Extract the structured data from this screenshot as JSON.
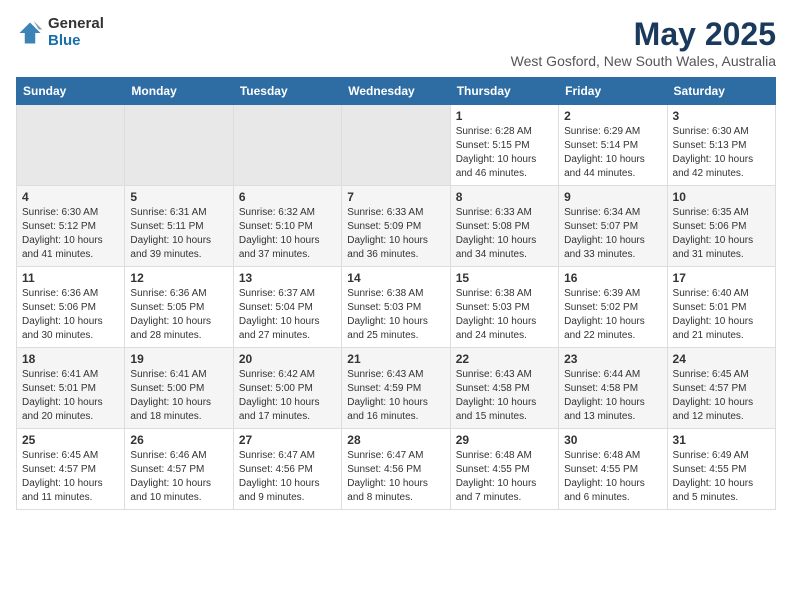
{
  "header": {
    "logo_general": "General",
    "logo_blue": "Blue",
    "title": "May 2025",
    "subtitle": "West Gosford, New South Wales, Australia"
  },
  "calendar": {
    "weekdays": [
      "Sunday",
      "Monday",
      "Tuesday",
      "Wednesday",
      "Thursday",
      "Friday",
      "Saturday"
    ],
    "weeks": [
      [
        {
          "day": "",
          "info": ""
        },
        {
          "day": "",
          "info": ""
        },
        {
          "day": "",
          "info": ""
        },
        {
          "day": "",
          "info": ""
        },
        {
          "day": "1",
          "info": "Sunrise: 6:28 AM\nSunset: 5:15 PM\nDaylight: 10 hours\nand 46 minutes."
        },
        {
          "day": "2",
          "info": "Sunrise: 6:29 AM\nSunset: 5:14 PM\nDaylight: 10 hours\nand 44 minutes."
        },
        {
          "day": "3",
          "info": "Sunrise: 6:30 AM\nSunset: 5:13 PM\nDaylight: 10 hours\nand 42 minutes."
        }
      ],
      [
        {
          "day": "4",
          "info": "Sunrise: 6:30 AM\nSunset: 5:12 PM\nDaylight: 10 hours\nand 41 minutes."
        },
        {
          "day": "5",
          "info": "Sunrise: 6:31 AM\nSunset: 5:11 PM\nDaylight: 10 hours\nand 39 minutes."
        },
        {
          "day": "6",
          "info": "Sunrise: 6:32 AM\nSunset: 5:10 PM\nDaylight: 10 hours\nand 37 minutes."
        },
        {
          "day": "7",
          "info": "Sunrise: 6:33 AM\nSunset: 5:09 PM\nDaylight: 10 hours\nand 36 minutes."
        },
        {
          "day": "8",
          "info": "Sunrise: 6:33 AM\nSunset: 5:08 PM\nDaylight: 10 hours\nand 34 minutes."
        },
        {
          "day": "9",
          "info": "Sunrise: 6:34 AM\nSunset: 5:07 PM\nDaylight: 10 hours\nand 33 minutes."
        },
        {
          "day": "10",
          "info": "Sunrise: 6:35 AM\nSunset: 5:06 PM\nDaylight: 10 hours\nand 31 minutes."
        }
      ],
      [
        {
          "day": "11",
          "info": "Sunrise: 6:36 AM\nSunset: 5:06 PM\nDaylight: 10 hours\nand 30 minutes."
        },
        {
          "day": "12",
          "info": "Sunrise: 6:36 AM\nSunset: 5:05 PM\nDaylight: 10 hours\nand 28 minutes."
        },
        {
          "day": "13",
          "info": "Sunrise: 6:37 AM\nSunset: 5:04 PM\nDaylight: 10 hours\nand 27 minutes."
        },
        {
          "day": "14",
          "info": "Sunrise: 6:38 AM\nSunset: 5:03 PM\nDaylight: 10 hours\nand 25 minutes."
        },
        {
          "day": "15",
          "info": "Sunrise: 6:38 AM\nSunset: 5:03 PM\nDaylight: 10 hours\nand 24 minutes."
        },
        {
          "day": "16",
          "info": "Sunrise: 6:39 AM\nSunset: 5:02 PM\nDaylight: 10 hours\nand 22 minutes."
        },
        {
          "day": "17",
          "info": "Sunrise: 6:40 AM\nSunset: 5:01 PM\nDaylight: 10 hours\nand 21 minutes."
        }
      ],
      [
        {
          "day": "18",
          "info": "Sunrise: 6:41 AM\nSunset: 5:01 PM\nDaylight: 10 hours\nand 20 minutes."
        },
        {
          "day": "19",
          "info": "Sunrise: 6:41 AM\nSunset: 5:00 PM\nDaylight: 10 hours\nand 18 minutes."
        },
        {
          "day": "20",
          "info": "Sunrise: 6:42 AM\nSunset: 5:00 PM\nDaylight: 10 hours\nand 17 minutes."
        },
        {
          "day": "21",
          "info": "Sunrise: 6:43 AM\nSunset: 4:59 PM\nDaylight: 10 hours\nand 16 minutes."
        },
        {
          "day": "22",
          "info": "Sunrise: 6:43 AM\nSunset: 4:58 PM\nDaylight: 10 hours\nand 15 minutes."
        },
        {
          "day": "23",
          "info": "Sunrise: 6:44 AM\nSunset: 4:58 PM\nDaylight: 10 hours\nand 13 minutes."
        },
        {
          "day": "24",
          "info": "Sunrise: 6:45 AM\nSunset: 4:57 PM\nDaylight: 10 hours\nand 12 minutes."
        }
      ],
      [
        {
          "day": "25",
          "info": "Sunrise: 6:45 AM\nSunset: 4:57 PM\nDaylight: 10 hours\nand 11 minutes."
        },
        {
          "day": "26",
          "info": "Sunrise: 6:46 AM\nSunset: 4:57 PM\nDaylight: 10 hours\nand 10 minutes."
        },
        {
          "day": "27",
          "info": "Sunrise: 6:47 AM\nSunset: 4:56 PM\nDaylight: 10 hours\nand 9 minutes."
        },
        {
          "day": "28",
          "info": "Sunrise: 6:47 AM\nSunset: 4:56 PM\nDaylight: 10 hours\nand 8 minutes."
        },
        {
          "day": "29",
          "info": "Sunrise: 6:48 AM\nSunset: 4:55 PM\nDaylight: 10 hours\nand 7 minutes."
        },
        {
          "day": "30",
          "info": "Sunrise: 6:48 AM\nSunset: 4:55 PM\nDaylight: 10 hours\nand 6 minutes."
        },
        {
          "day": "31",
          "info": "Sunrise: 6:49 AM\nSunset: 4:55 PM\nDaylight: 10 hours\nand 5 minutes."
        }
      ]
    ]
  }
}
